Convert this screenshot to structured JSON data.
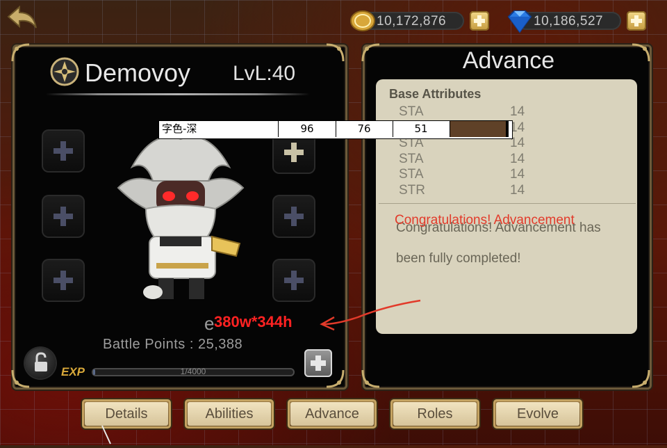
{
  "currency": {
    "gold": "10,172,876",
    "gems": "10,186,527"
  },
  "hero": {
    "name": "Demovoy",
    "level": "LvL:40",
    "partial_label": "e",
    "battle_points": "Battle Points : 25,388",
    "exp_label": "EXP",
    "exp_text": "1/4000",
    "exp_fraction": 0.01
  },
  "advance": {
    "title": "Advance",
    "section_title": "Base Attributes",
    "attributes": [
      {
        "name": "STA",
        "value": "14"
      },
      {
        "name": "",
        "value": "14"
      },
      {
        "name": "STA",
        "value": "14"
      },
      {
        "name": "STA",
        "value": "14"
      },
      {
        "name": "STA",
        "value": "14"
      },
      {
        "name": "STR",
        "value": "14"
      }
    ],
    "congrats_red": "Congratulations! Advancement",
    "congrats_line1": "Congratulations! Advancement has",
    "congrats_line2": "been fully completed!"
  },
  "annotation": {
    "dimensions": "380w*344h",
    "table_label": "字色-深",
    "table_values": [
      "96",
      "76",
      "51"
    ],
    "table_swatch": "#5f4128"
  },
  "tabs": [
    {
      "label": "Details"
    },
    {
      "label": "Abilities"
    },
    {
      "label": "Advance"
    },
    {
      "label": "Roles"
    },
    {
      "label": "Evolve"
    }
  ],
  "colors": {
    "accent_gold": "#d9a93a",
    "annotation_red": "#e23a2a"
  }
}
